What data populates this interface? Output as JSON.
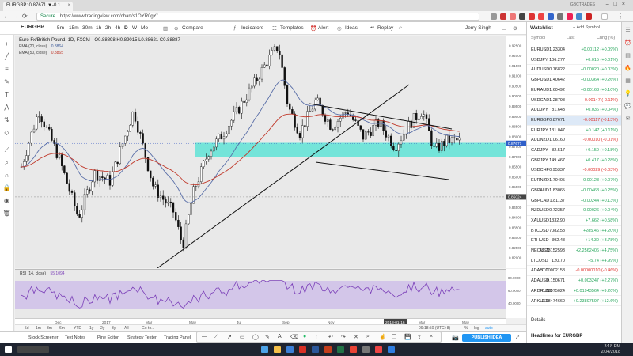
{
  "browser": {
    "tab_title": "EURGBP: 0.87671 ▼-0.1",
    "url": "https://www.tradingview.com/chart/s1OYR0gY/",
    "secure_label": "Secure",
    "user_label": "GBCTRADES"
  },
  "toolbar": {
    "symbol": "EURGBP",
    "intervals": [
      "5m",
      "15m",
      "30m",
      "1h",
      "2h",
      "4h",
      "D",
      "W",
      "Mo"
    ],
    "compare_label": "Compare",
    "indicators_label": "Indicators",
    "templates_label": "Templates",
    "alert_label": "Alert",
    "ideas_label": "Ideas",
    "replay_label": "Replay",
    "user_name": "Jerry Singh"
  },
  "chart": {
    "legend_title": "Euro Fx/British Pound, 1D, FXCM",
    "legend_ohlc": "O0.88898 H0.89015 L0.88621 C0.88887",
    "ema20_label": "EMA (20, close)",
    "ema20_value": "0.8864",
    "ema50_label": "EMA (50, close)",
    "ema50_value": "0.8865",
    "price_ticks": [
      "0.92500",
      "0.92000",
      "0.91500",
      "0.91000",
      "0.90500",
      "0.90000",
      "0.89500",
      "0.89000",
      "0.88500",
      "0.88000",
      "0.87500",
      "0.87000",
      "0.86500",
      "0.86000",
      "0.85500",
      "0.85000",
      "0.84500",
      "0.84000",
      "0.83500",
      "0.83000",
      "0.82500",
      "0.82000"
    ],
    "last_price_tag": "0.87671",
    "cursor_price_tag": "0.85024",
    "time_ticks": [
      "Dec",
      "2017",
      "Mar",
      "May",
      "Jul",
      "Sep",
      "Nov",
      "2018-01-16",
      "Mar",
      "May"
    ],
    "rsi_label": "RSI (14, close)",
    "rsi_value": "55.1094",
    "rsi_ticks": [
      "80.0000",
      "60.0000",
      "40.0000"
    ]
  },
  "rangebar": {
    "items": [
      "5d",
      "1m",
      "3m",
      "6m",
      "YTD",
      "1y",
      "2y",
      "3y",
      "All",
      "Go to..."
    ],
    "right_text": "09:18:50 (UTC+8)",
    "right_items": [
      "%",
      "log",
      "auto"
    ]
  },
  "bottom_tabs": [
    "Stock Screener",
    "Text Notes",
    "Pine Editor",
    "Strategy Tester",
    "Trading Panel"
  ],
  "publish_label": "PUBLISH IDEA",
  "watchlist": {
    "title": "Watchlist",
    "add_symbol": "Add Symbol",
    "columns": [
      "Symbol",
      "Last",
      "Chng (%)"
    ],
    "rows": [
      {
        "sym": "EURUSD",
        "last": "1.23304",
        "chg": "+0.00112 (+0.09%)",
        "dir": "pos"
      },
      {
        "sym": "USDJPY",
        "last": "106.277",
        "chg": "+0.015 (+0.01%)",
        "dir": "pos"
      },
      {
        "sym": "AUDUSD",
        "last": "0.76822",
        "chg": "+0.00020 (+0.03%)",
        "dir": "pos"
      },
      {
        "sym": "GBPUSD",
        "last": "1.40642",
        "chg": "+0.00364 (+0.26%)",
        "dir": "pos"
      },
      {
        "sym": "EURAUD",
        "last": "1.60492",
        "chg": "+0.00163 (+0.10%)",
        "dir": "pos"
      },
      {
        "sym": "USDCAD",
        "last": "1.28798",
        "chg": "-0.00147 (-0.11%)",
        "dir": "neg"
      },
      {
        "sym": "AUDJPY",
        "last": "81.643",
        "chg": "+0.036 (+0.04%)",
        "dir": "pos"
      },
      {
        "sym": "EURGBP",
        "last": "0.87671",
        "chg": "-0.00117 (-0.13%)",
        "dir": "neg",
        "selected": true
      },
      {
        "sym": "EURJPY",
        "last": "131.047",
        "chg": "+0.147 (+0.11%)",
        "dir": "pos"
      },
      {
        "sym": "AUDNZD",
        "last": "1.06160",
        "chg": "-0.00010 (-0.01%)",
        "dir": "neg"
      },
      {
        "sym": "CADJPY",
        "last": "82.517",
        "chg": "+0.150 (+0.18%)",
        "dir": "pos"
      },
      {
        "sym": "GBPJPY",
        "last": "149.467",
        "chg": "+0.417 (+0.28%)",
        "dir": "pos"
      },
      {
        "sym": "USDCHF",
        "last": "0.95337",
        "chg": "-0.00029 (-0.03%)",
        "dir": "neg"
      },
      {
        "sym": "EURNZD",
        "last": "1.70405",
        "chg": "+0.00123 (+0.07%)",
        "dir": "pos"
      },
      {
        "sym": "GBPAUD",
        "last": "1.83065",
        "chg": "+0.00463 (+0.25%)",
        "dir": "pos"
      },
      {
        "sym": "GBPCAD",
        "last": "1.81137",
        "chg": "+0.00244 (+0.13%)",
        "dir": "pos"
      },
      {
        "sym": "NZDUSD",
        "last": "0.72357",
        "chg": "+0.00026 (+0.04%)",
        "dir": "pos"
      },
      {
        "sym": "XAUUSD",
        "last": "1332.90",
        "chg": "+7.662 (+0.58%)",
        "dir": "pos"
      },
      {
        "sym": "BTCUSD",
        "last": "7082.58",
        "chg": "+285.46 (+4.20%)",
        "dir": "pos"
      },
      {
        "sym": "ETHUSD",
        "last": "392.48",
        "chg": "+14.30 (+3.78%)",
        "dir": "pos"
      },
      {
        "sym": "NEOUSD",
        "last": "49.73152593",
        "chg": "+2.2562406 (+4.75%)",
        "dir": "pos"
      },
      {
        "sym": "LTCUSD",
        "last": "120.70",
        "chg": "+5.74 (+4.99%)",
        "dir": "pos"
      },
      {
        "sym": "ADABTC",
        "last": "0.00002158",
        "chg": "-0.00000010 (-0.46%)",
        "dir": "neg"
      },
      {
        "sym": "ADAUSD",
        "last": "0.150671",
        "chg": "+0.003247 (+2.27%)",
        "dir": "pos"
      },
      {
        "sym": "ARDRUSD",
        "last": "0.23075024",
        "chg": "+0.01943564 (+9.20%)",
        "dir": "pos"
      },
      {
        "sym": "ARKUSD",
        "last": "2.13474660",
        "chg": "+0.23897597 (+12.6%)",
        "dir": "pos"
      }
    ],
    "details_label": "Details",
    "headlines_label": "Headlines for EURGBP"
  },
  "taskbar": {
    "time": "3:18 PM",
    "date": "2/04/2018"
  }
}
